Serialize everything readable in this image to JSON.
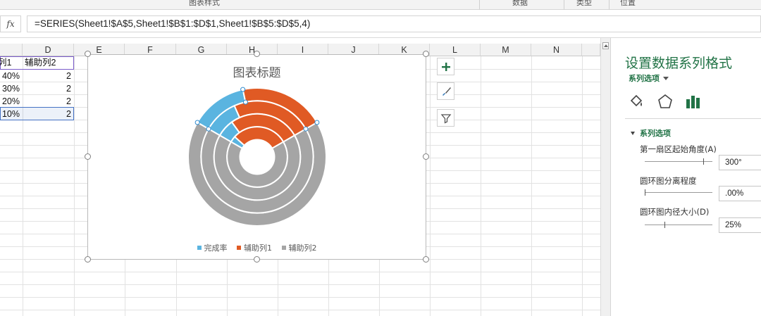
{
  "ribbon": {
    "groups": [
      "图表样式",
      "数据",
      "类型",
      "位置"
    ]
  },
  "formula_bar": {
    "fx_label": "fx",
    "formula": "=SERIES(Sheet1!$A$5,Sheet1!$B$1:$D$1,Sheet1!$B$5:$D$5,4)"
  },
  "sheet": {
    "columns": [
      "D",
      "E",
      "F",
      "G",
      "H",
      "I",
      "J",
      "K",
      "L",
      "M",
      "N"
    ],
    "header_row": {
      "c": "列1",
      "d": "辅助列2"
    },
    "rows": [
      {
        "c": "40%",
        "d": "2"
      },
      {
        "c": "30%",
        "d": "2"
      },
      {
        "c": "20%",
        "d": "2"
      },
      {
        "c": "10%",
        "d": "2"
      }
    ]
  },
  "chart": {
    "title": "图表标题",
    "legend": [
      {
        "name": "完成率",
        "color": "#5ab4e0"
      },
      {
        "name": "辅助列1",
        "color": "#e05a24"
      },
      {
        "name": "辅助列2",
        "color": "#a5a5a5"
      }
    ],
    "side_buttons": [
      "plus-icon",
      "brush-icon",
      "filter-icon"
    ]
  },
  "chart_data": {
    "type": "doughnut",
    "title": "图表标题",
    "first_slice_angle_deg": 300,
    "hole_size_pct": 25,
    "rings": [
      {
        "values": {
          "完成率": 0.4,
          "辅助列1": 0.6,
          "辅助列2": 2
        }
      },
      {
        "values": {
          "完成率": 0.3,
          "辅助列1": 0.7,
          "辅助列2": 2
        }
      },
      {
        "values": {
          "完成率": 0.2,
          "辅助列1": 0.8,
          "辅助列2": 2
        }
      },
      {
        "values": {
          "完成率": 0.1,
          "辅助列1": 0.9,
          "辅助列2": 2
        }
      }
    ],
    "series_names": [
      "完成率",
      "辅助列1",
      "辅助列2"
    ],
    "colors": [
      "#5ab4e0",
      "#e05a24",
      "#a5a5a5"
    ],
    "legend_position": "bottom"
  },
  "pane": {
    "title": "设置数据系列格式",
    "subtitle": "系列选项",
    "section": "系列选项",
    "fields": [
      {
        "label": "第一扇区起始角度(A)",
        "value": "300°"
      },
      {
        "label": "圆环图分离程度",
        "value": ".00%"
      },
      {
        "label": "圆环图内径大小(D)",
        "value": "25%"
      }
    ]
  }
}
